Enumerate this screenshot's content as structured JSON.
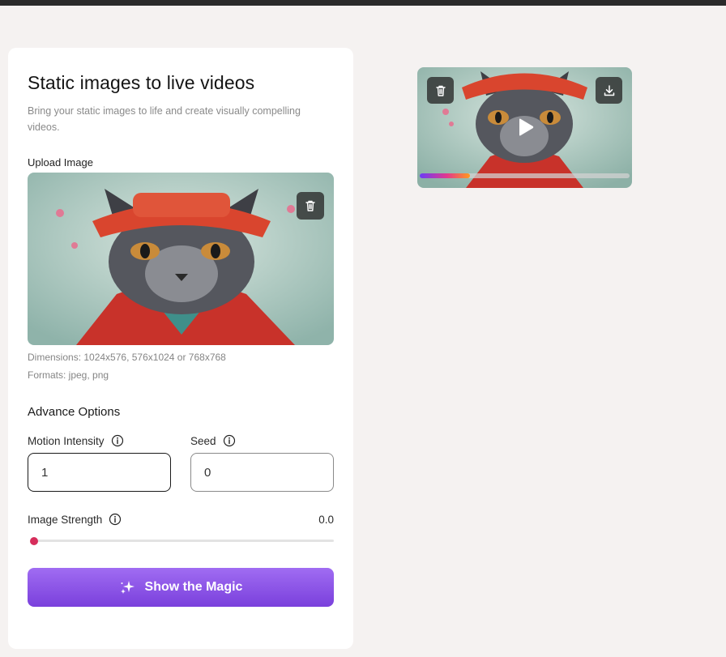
{
  "panel": {
    "title": "Static images to live videos",
    "subtitle": "Bring your static images to life and create visually compelling videos.",
    "upload_label": "Upload Image",
    "upload_image_icon": "trash-icon",
    "hint_dimensions": "Dimensions: 1024x576, 576x1024 or 768x768",
    "hint_formats": "Formats: jpeg, png",
    "advance_options_title": "Advance Options",
    "motion_intensity": {
      "label": "Motion Intensity",
      "value": "1"
    },
    "seed": {
      "label": "Seed",
      "value": "0"
    },
    "image_strength": {
      "label": "Image Strength",
      "value_text": "0.0",
      "value": 0.0
    },
    "submit_label": "Show the Magic"
  },
  "video": {
    "delete_icon": "trash-icon",
    "download_icon": "download-icon",
    "play_icon": "play-icon",
    "progress": 0.24
  },
  "colors": {
    "accent": "#7a40dc",
    "slider_thumb": "#d62d5b",
    "background": "#f5f2f1"
  }
}
